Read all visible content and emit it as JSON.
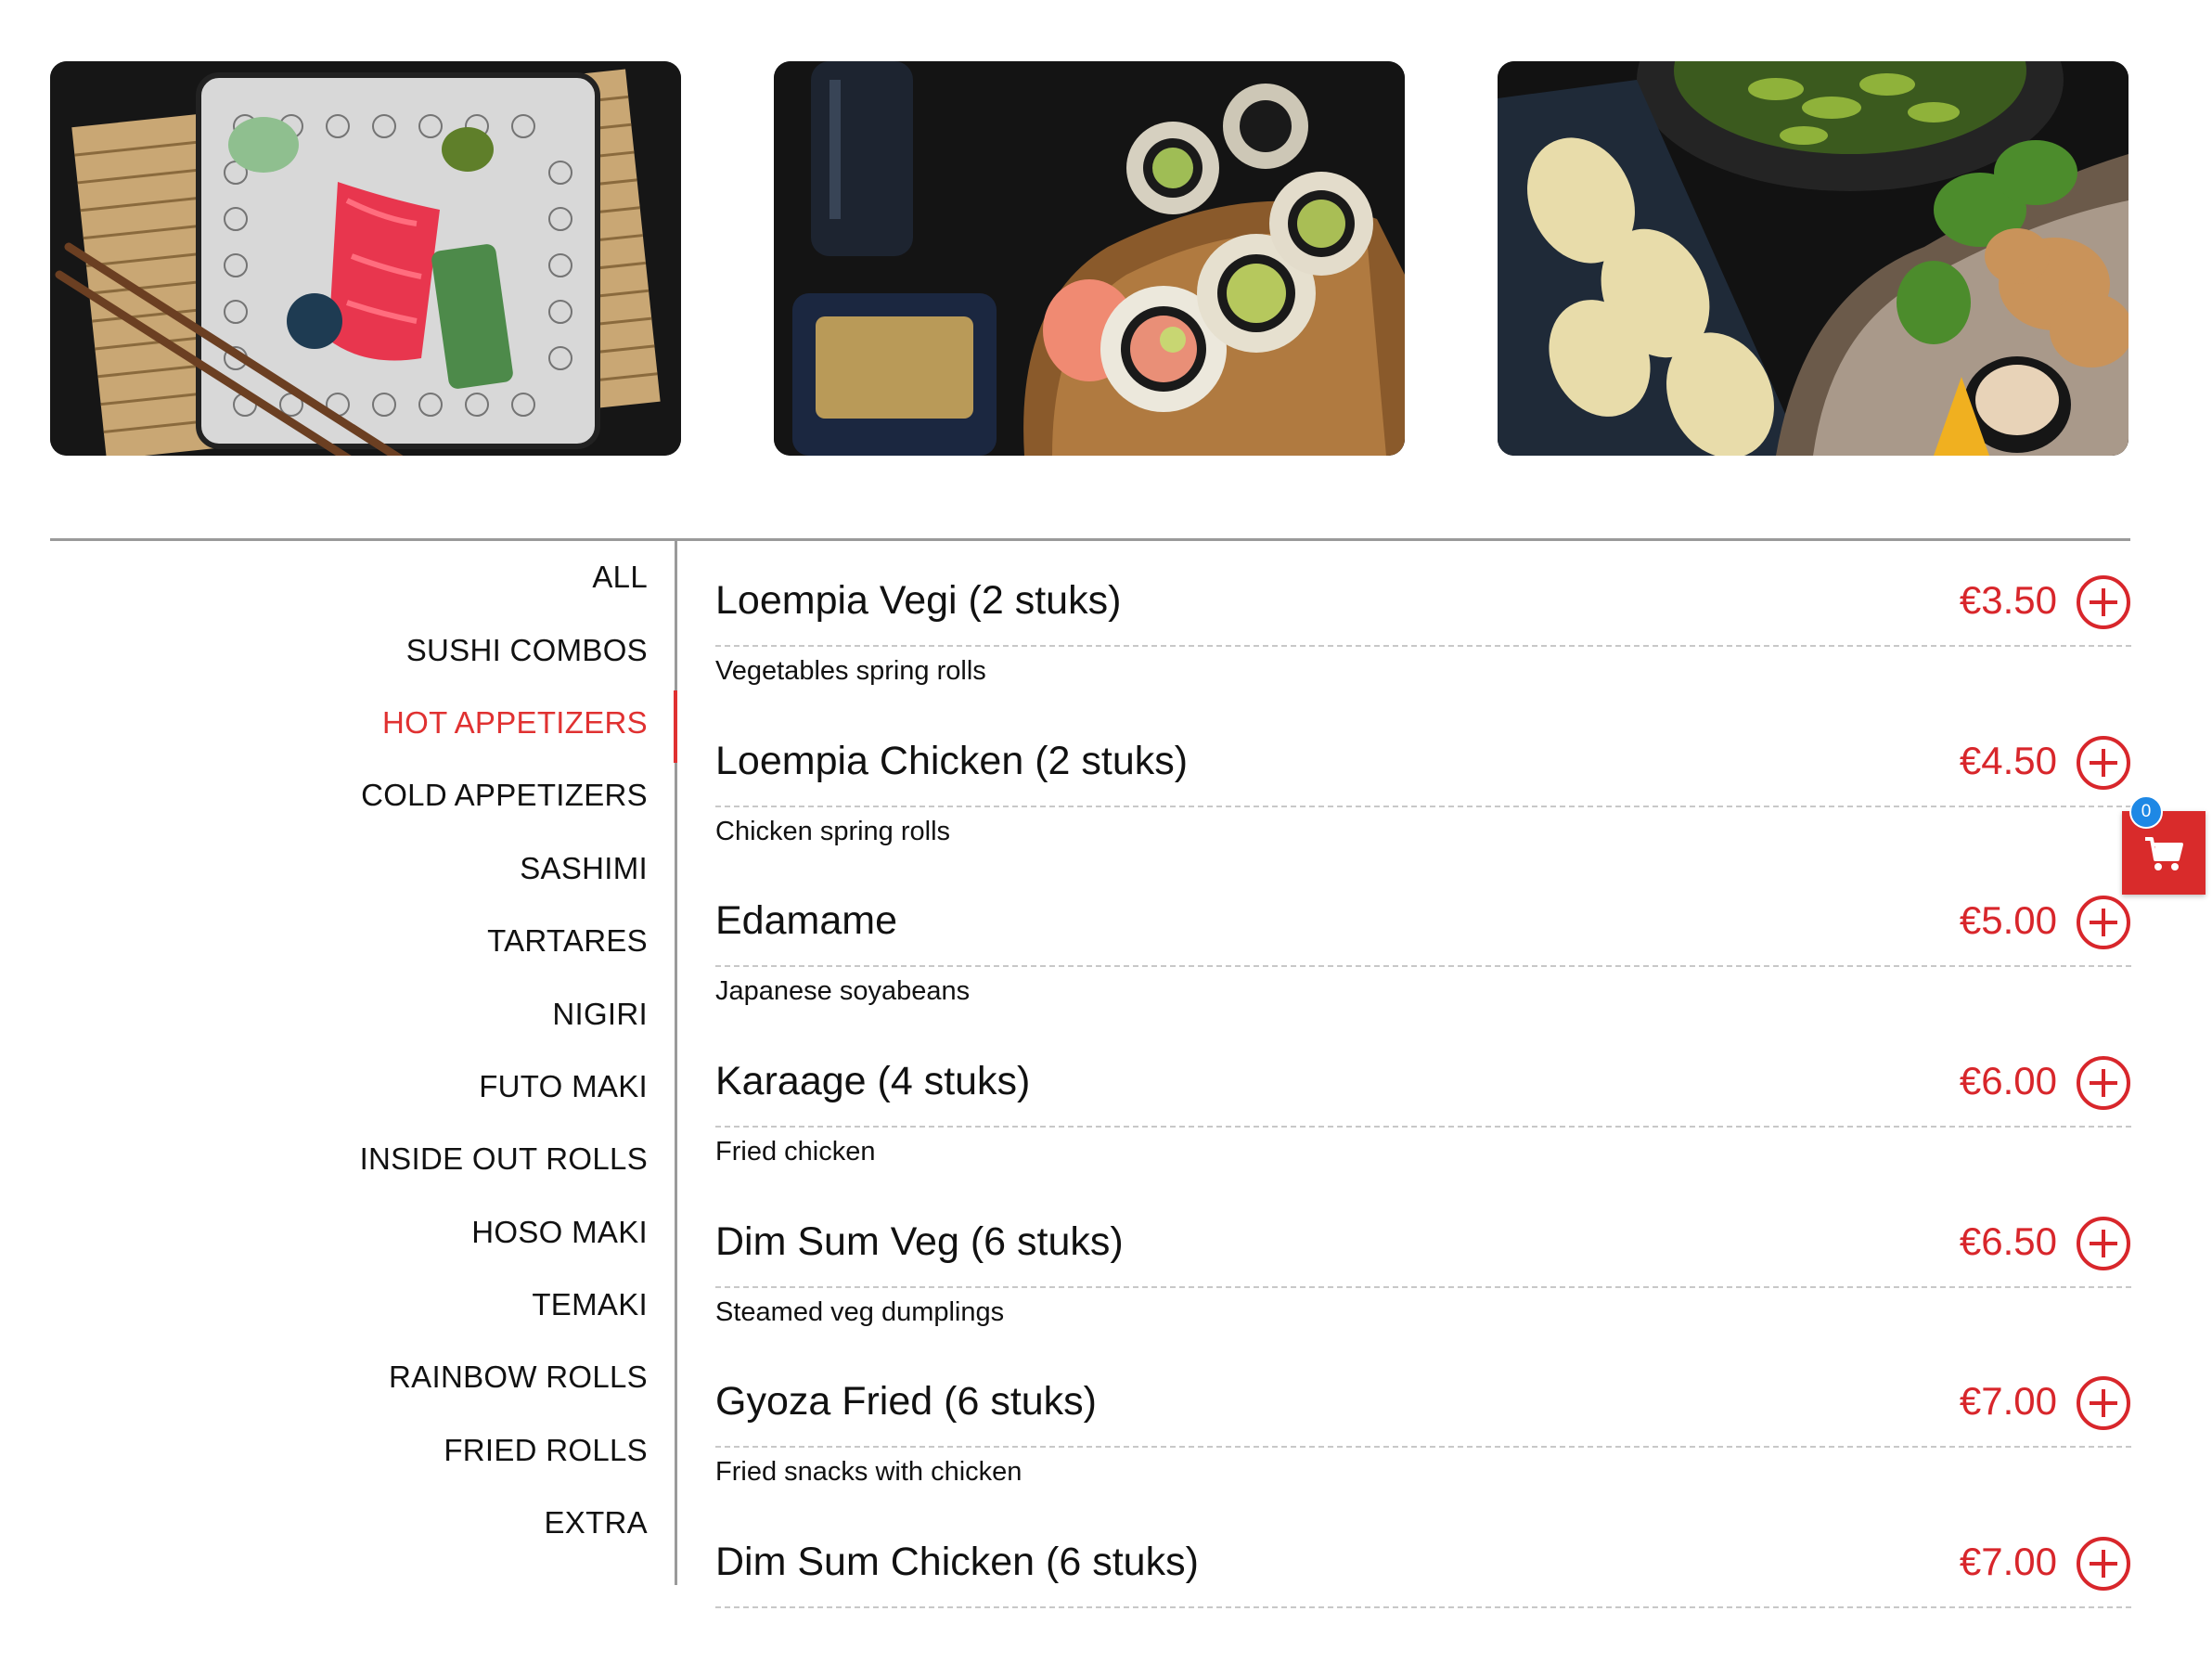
{
  "colors": {
    "accent": "#e03131",
    "price": "#d8262b",
    "cart": "#d92b2b",
    "badge": "#1e88e5"
  },
  "hero_images": [
    {
      "name": "sashimi-platter-photo"
    },
    {
      "name": "sushi-rolls-photo"
    },
    {
      "name": "gyoza-karaage-photo"
    }
  ],
  "categories": [
    {
      "label": "ALL"
    },
    {
      "label": "SUSHI COMBOS"
    },
    {
      "label": "HOT APPETIZERS",
      "active": true
    },
    {
      "label": "COLD APPETIZERS"
    },
    {
      "label": "SASHIMI"
    },
    {
      "label": "TARTARES"
    },
    {
      "label": "NIGIRI"
    },
    {
      "label": "FUTO MAKI"
    },
    {
      "label": "INSIDE OUT ROLLS"
    },
    {
      "label": "HOSO MAKI"
    },
    {
      "label": "TEMAKI"
    },
    {
      "label": "RAINBOW ROLLS"
    },
    {
      "label": "FRIED ROLLS"
    },
    {
      "label": "EXTRA"
    }
  ],
  "menu_items": [
    {
      "name": "Loempia Vegi (2 stuks)",
      "price": "€3.50",
      "description": "Vegetables spring rolls"
    },
    {
      "name": "Loempia Chicken (2 stuks)",
      "price": "€4.50",
      "description": "Chicken spring rolls"
    },
    {
      "name": "Edamame",
      "price": "€5.00",
      "description": "Japanese soyabeans"
    },
    {
      "name": "Karaage (4 stuks)",
      "price": "€6.00",
      "description": "Fried chicken"
    },
    {
      "name": "Dim Sum Veg (6 stuks)",
      "price": "€6.50",
      "description": "Steamed veg dumplings"
    },
    {
      "name": "Gyoza Fried (6 stuks)",
      "price": "€7.00",
      "description": "Fried snacks with chicken"
    },
    {
      "name": "Dim Sum Chicken (6 stuks)",
      "price": "€7.00",
      "description": ""
    }
  ],
  "cart": {
    "count": "0",
    "icon": "shopping-cart-icon"
  },
  "add_icon": "plus-circle-icon"
}
